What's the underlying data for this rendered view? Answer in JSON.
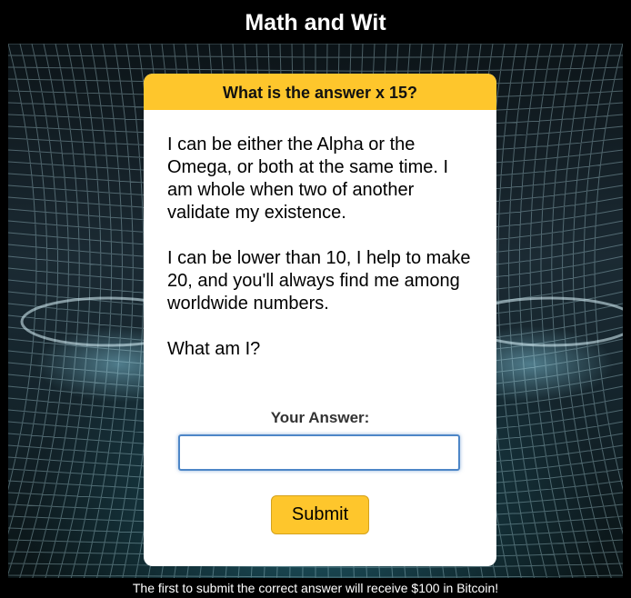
{
  "header": {
    "title": "Math and Wit"
  },
  "card": {
    "title": "What is the answer x 15?",
    "riddle_paragraphs": [
      "I can be either the Alpha or the Omega, or both at the same time. I am whole when two of another validate my existence.",
      "I can be lower than 10, I help to make 20, and you'll always find me among worldwide numbers.",
      "What am I?"
    ],
    "answer_label": "Your Answer:",
    "answer_value": "",
    "submit_label": "Submit"
  },
  "footer": {
    "text": "The first to submit the correct answer will receive $100 in Bitcoin!"
  },
  "colors": {
    "accent": "#fec62c",
    "input_border": "#4d86c7",
    "bar": "#000000"
  }
}
